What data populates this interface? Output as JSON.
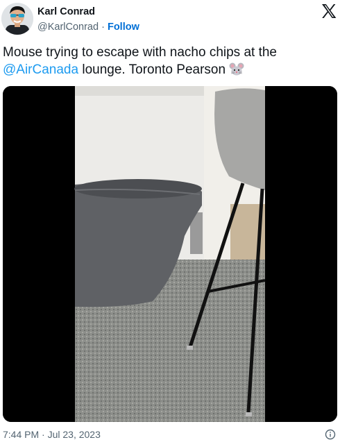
{
  "author": {
    "display_name": "Karl Conrad",
    "handle": "@KarlConrad",
    "separator": "·",
    "follow_label": "Follow"
  },
  "tweet": {
    "text_before": "Mouse trying to escape with nacho chips at the",
    "mention": "@AirCanada",
    "text_after": " lounge. Toronto Pearson ",
    "emoji_icon": "mouse-face-emoji"
  },
  "footer": {
    "timestamp": "7:44 PM · Jul 23, 2023"
  },
  "icons": {
    "brand": "x-logo-icon",
    "info": "info-icon"
  },
  "colors": {
    "link": "#1d9bf0",
    "follow": "#006fd6",
    "secondary_text": "#536471",
    "primary_text": "#0f1419"
  }
}
